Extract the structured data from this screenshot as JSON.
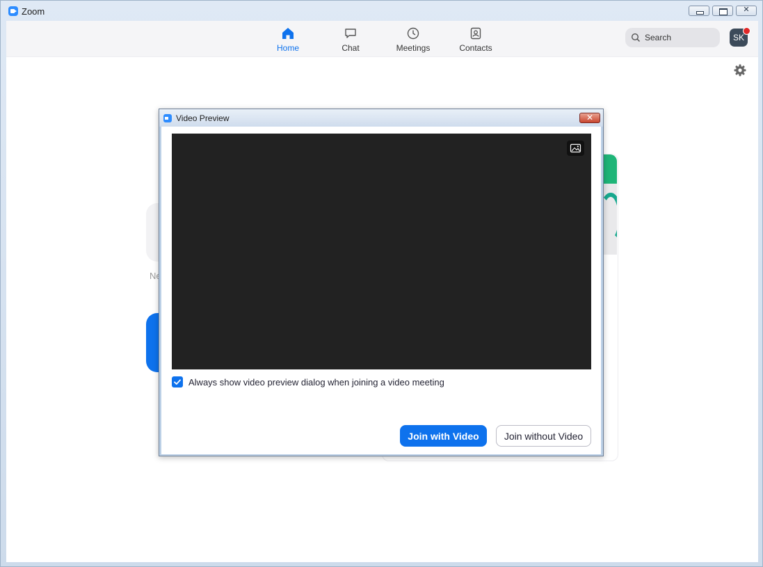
{
  "window": {
    "title": "Zoom"
  },
  "nav": {
    "items": [
      {
        "label": "Home",
        "icon": "home-icon",
        "active": true
      },
      {
        "label": "Chat",
        "icon": "chat-icon",
        "active": false
      },
      {
        "label": "Meetings",
        "icon": "clock-icon",
        "active": false
      },
      {
        "label": "Contacts",
        "icon": "contacts-icon",
        "active": false
      }
    ],
    "search_label": "Search",
    "avatar_initials": "SK"
  },
  "background": {
    "partial_text": "Ne"
  },
  "dialog": {
    "title": "Video Preview",
    "close_glyph": "✕",
    "checkbox_label": "Always show video preview dialog when joining a video meeting",
    "checkbox_checked": true,
    "join_with_video": "Join with Video",
    "join_without_video": "Join without Video"
  },
  "colors": {
    "accent": "#0e72ed",
    "video_bg": "#222222",
    "close_red": "#c9462f"
  }
}
